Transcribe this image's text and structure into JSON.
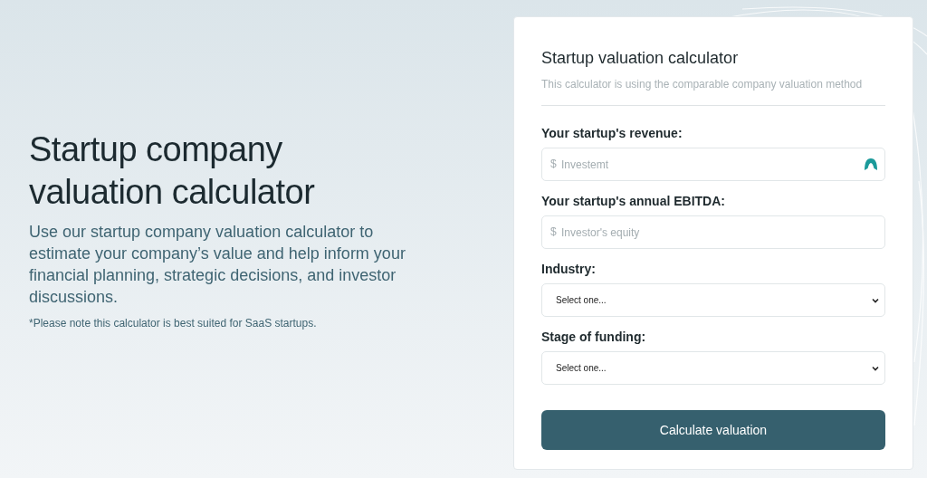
{
  "hero": {
    "title": "Startup company valuation calculator",
    "description": "Use our startup company valuation calculator to estimate your company’s value and help inform your financial planning, strategic decisions, and investor discussions.",
    "note": "*Please note this calculator is best suited for SaaS startups."
  },
  "card": {
    "title": "Startup valuation calculator",
    "subtitle": "This calculator is using the comparable company valuation method",
    "fields": [
      {
        "kind": "money",
        "label": "Your startup's revenue:",
        "prefix": "$",
        "placeholder": "Investemt",
        "autofill_badge": true
      },
      {
        "kind": "money",
        "label": "Your startup's annual EBITDA:",
        "prefix": "$",
        "placeholder": "Investor's equity",
        "autofill_badge": false
      },
      {
        "kind": "select",
        "label": "Industry:",
        "value": "Select one..."
      },
      {
        "kind": "select",
        "label": "Stage of funding:",
        "value": "Select one..."
      }
    ],
    "button": "Calculate valuation"
  }
}
